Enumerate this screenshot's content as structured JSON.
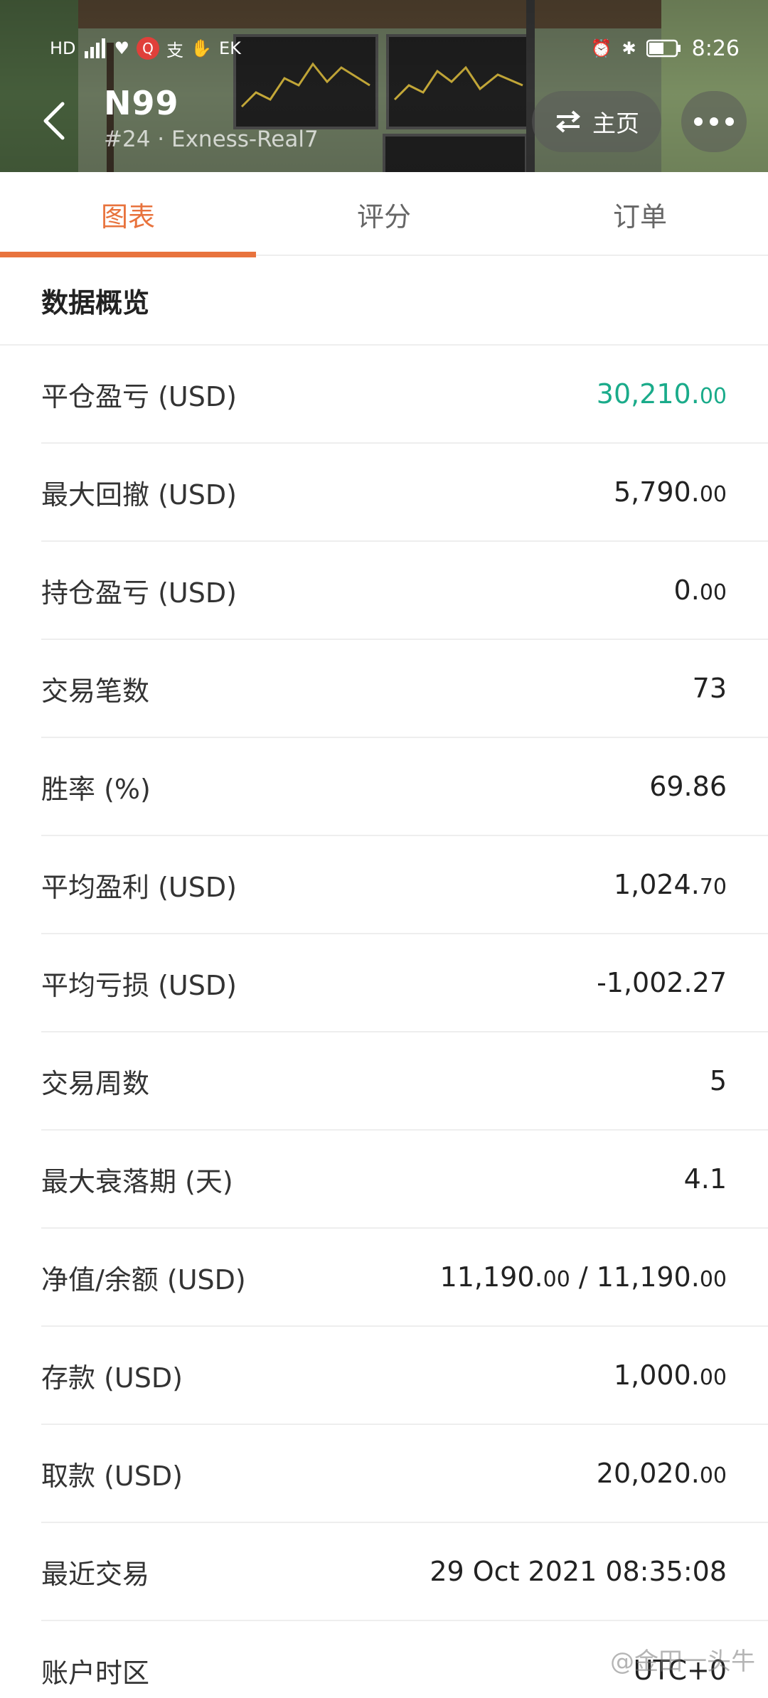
{
  "statusbar": {
    "left_icons": [
      "HD",
      "signal",
      "heart",
      "Q",
      "支",
      "hand",
      "EK"
    ],
    "time": "8:26"
  },
  "header": {
    "title": "N99",
    "subtitle": "#24 · Exness-Real7",
    "home_label": "主页"
  },
  "tabs": [
    {
      "label": "图表",
      "active": true
    },
    {
      "label": "评分",
      "active": false
    },
    {
      "label": "订单",
      "active": false
    }
  ],
  "section_title": "数据概览",
  "colors": {
    "accent": "#e8733d",
    "positive": "#1aab8a",
    "divider": "#eeeeee"
  },
  "stats": [
    {
      "label": "平仓盈亏 (USD)",
      "int": "30,210.",
      "dec": "00",
      "positive": true
    },
    {
      "label": "最大回撤 (USD)",
      "int": "5,790.",
      "dec": "00"
    },
    {
      "label": "持仓盈亏 (USD)",
      "int": "0.",
      "dec": "00"
    },
    {
      "label": "交易笔数",
      "int": "73",
      "dec": ""
    },
    {
      "label": "胜率 (%)",
      "int": "69.86",
      "dec": ""
    },
    {
      "label": "平均盈利 (USD)",
      "int": "1,024.",
      "dec": "70"
    },
    {
      "label": "平均亏损 (USD)",
      "int": "-1,002.27",
      "dec": ""
    },
    {
      "label": "交易周数",
      "int": "5",
      "dec": ""
    },
    {
      "label": "最大衰落期 (天)",
      "int": "4.1",
      "dec": ""
    },
    {
      "label": "净值/余额 (USD)",
      "int": "11,190.",
      "dec": "00",
      "int2": " / 11,190.",
      "dec2": "00"
    },
    {
      "label": "存款 (USD)",
      "int": "1,000.",
      "dec": "00"
    },
    {
      "label": "取款 (USD)",
      "int": "20,020.",
      "dec": "00"
    },
    {
      "label": "最近交易",
      "int": "29 Oct 2021 08:35:08",
      "dec": ""
    },
    {
      "label": "账户时区",
      "int": "UTC+0",
      "dec": ""
    }
  ],
  "watermark": "@金田一头牛"
}
